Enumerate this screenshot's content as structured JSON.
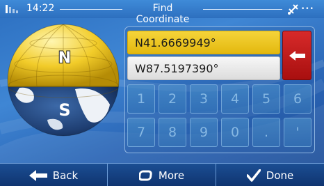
{
  "status_bar": {
    "time": "14:22",
    "title": "Find Coordinate",
    "signal_icon": "signal-bars-icon",
    "gps_icon": "gps-satellite-icon",
    "indicator": "•••"
  },
  "globe": {
    "north_label": "N",
    "south_label": "S",
    "colors": {
      "north": "#f2cc2a",
      "south": "#1f3f73"
    }
  },
  "coordinates": {
    "latitude": "N41.6669949°",
    "longitude": "W87.5197390°"
  },
  "backspace": {
    "icon": "backspace-arrow-icon",
    "color": "#c41c1c"
  },
  "keypad": {
    "keys": [
      "1",
      "2",
      "3",
      "4",
      "5",
      "6",
      "7",
      "8",
      "9",
      "0",
      ".",
      "'"
    ]
  },
  "bottom_bar": {
    "back_label": "Back",
    "more_label": "More",
    "done_label": "Done",
    "back_icon": "arrow-left-icon",
    "more_icon": "rounded-square-icon",
    "done_icon": "checkmark-icon"
  }
}
